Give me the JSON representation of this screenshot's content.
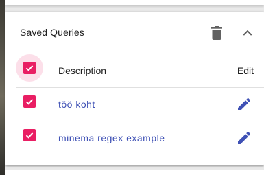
{
  "panel": {
    "title": "Saved Queries",
    "delete_icon": "trash-icon",
    "collapse_icon": "chevron-up-icon"
  },
  "table": {
    "header": {
      "select_all_checked": true,
      "description_label": "Description",
      "edit_label": "Edit"
    },
    "rows": [
      {
        "checked": true,
        "description": "töö koht",
        "edit_icon": "pencil-icon"
      },
      {
        "checked": true,
        "description": "minema regex example",
        "edit_icon": "pencil-icon"
      }
    ]
  },
  "colors": {
    "accent": "#e91e63",
    "link": "#3f51b5",
    "icon": "#616161",
    "text": "#212121"
  }
}
